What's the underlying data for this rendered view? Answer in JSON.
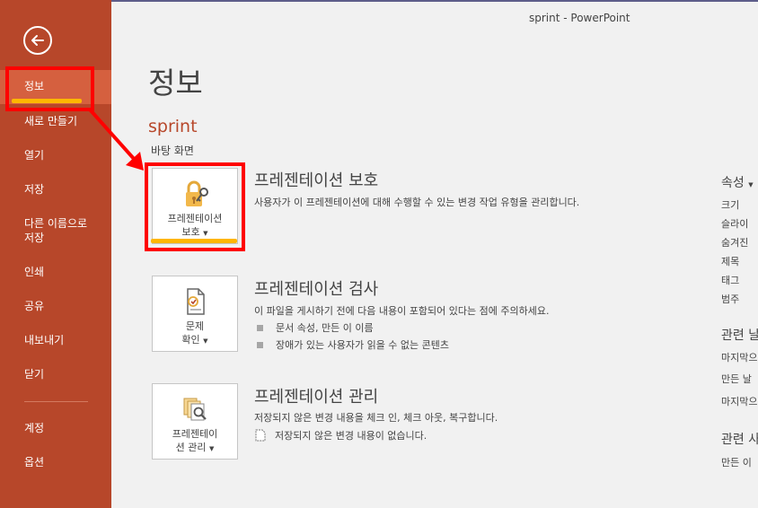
{
  "window": {
    "title": "sprint - PowerPoint"
  },
  "sidebar": {
    "back_icon": "arrow-left-icon",
    "items": [
      {
        "label": "정보"
      },
      {
        "label": "새로 만들기"
      },
      {
        "label": "열기"
      },
      {
        "label": "저장"
      },
      {
        "label": "다른 이름으로 저장"
      },
      {
        "label": "인쇄"
      },
      {
        "label": "공유"
      },
      {
        "label": "내보내기"
      },
      {
        "label": "닫기"
      },
      {
        "label": "계정"
      },
      {
        "label": "옵션"
      }
    ]
  },
  "main": {
    "title": "정보",
    "file_name": "sprint",
    "file_location": "바탕 화면",
    "sections": [
      {
        "button_label_1": "프레젠테이션",
        "button_label_2": "보호",
        "icon": "lock-key-icon",
        "title": "프레젠테이션 보호",
        "description": "사용자가 이 프레젠테이션에 대해 수행할 수 있는 변경 작업 유형을 관리합니다."
      },
      {
        "button_label_1": "문제",
        "button_label_2": "확인",
        "icon": "document-check-icon",
        "title": "프레젠테이션 검사",
        "description": "이 파일을 게시하기 전에 다음 내용이 포함되어 있다는 점에 주의하세요.",
        "bullets": [
          "문서 속성, 만든 이 이름",
          "장애가 있는 사용자가 읽을 수 없는 콘텐츠"
        ]
      },
      {
        "button_label_1": "프레젠테이",
        "button_label_2": "션 관리",
        "icon": "document-search-icon",
        "title": "프레젠테이션 관리",
        "description": "저장되지 않은 변경 내용을 체크 인, 체크 아웃, 복구합니다.",
        "note": "저장되지 않은 변경 내용이 없습니다."
      }
    ]
  },
  "right_panel": {
    "properties_heading": "속성",
    "properties": [
      "크기",
      "슬라이",
      "숨겨진",
      "제목",
      "태그",
      "범주"
    ],
    "related_dates_heading": "관련 날",
    "related_dates": [
      "마지막으",
      "만든 날",
      "마지막으"
    ],
    "related_people_heading": "관련 사",
    "related_people": [
      "만든 이"
    ]
  },
  "colors": {
    "sidebar": "#b7472a",
    "sidebar_active": "#d5603f",
    "annotation_red": "#ff0000",
    "annotation_yellow": "#ffb600"
  }
}
